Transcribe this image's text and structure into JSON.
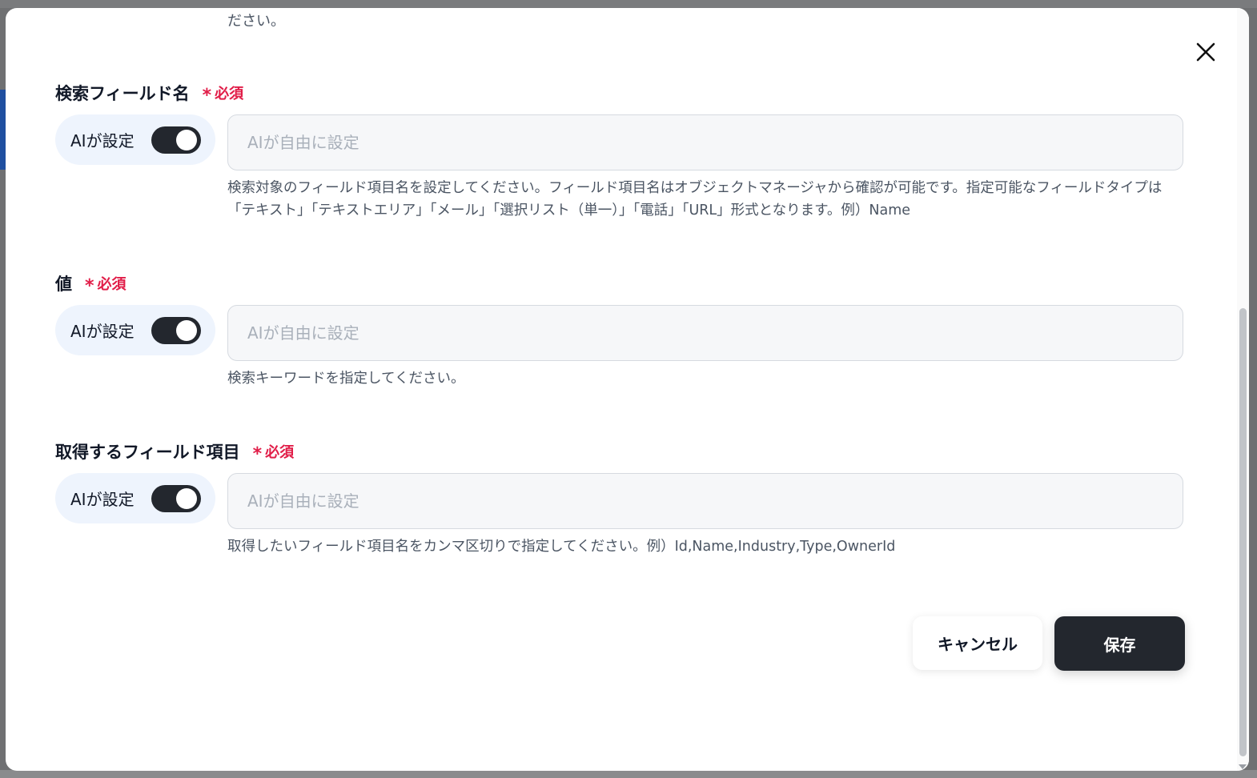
{
  "modal": {
    "truncated_top_text": "ださい。",
    "fields": [
      {
        "label": "検索フィールド名",
        "required": "必須",
        "ai_label": "AIが設定",
        "ai_enabled": true,
        "placeholder": "AIが自由に設定",
        "value": "",
        "help": "検索対象のフィールド項目名を設定してください。フィールド項目名はオブジェクトマネージャから確認が可能です。指定可能なフィールドタイプは「テキスト」「テキストエリア」「メール」「選択リスト（単一）」「電話」「URL」形式となります。例）Name"
      },
      {
        "label": "値",
        "required": "必須",
        "ai_label": "AIが設定",
        "ai_enabled": true,
        "placeholder": "AIが自由に設定",
        "value": "",
        "help": "検索キーワードを指定してください。"
      },
      {
        "label": "取得するフィールド項目",
        "required": "必須",
        "ai_label": "AIが設定",
        "ai_enabled": true,
        "placeholder": "AIが自由に設定",
        "value": "",
        "help": "取得したいフィールド項目名をカンマ区切りで指定してください。例）Id,Name,Industry,Type,OwnerId"
      }
    ],
    "buttons": {
      "cancel": "キャンセル",
      "save": "保存"
    }
  },
  "icons": {
    "close": "close-icon",
    "required_marker": "asterisk-icon"
  },
  "colors": {
    "required": "#e11d48",
    "toggle_on": "#23272e",
    "ai_pill_bg": "#eef4fd",
    "primary_button": "#23272e"
  }
}
